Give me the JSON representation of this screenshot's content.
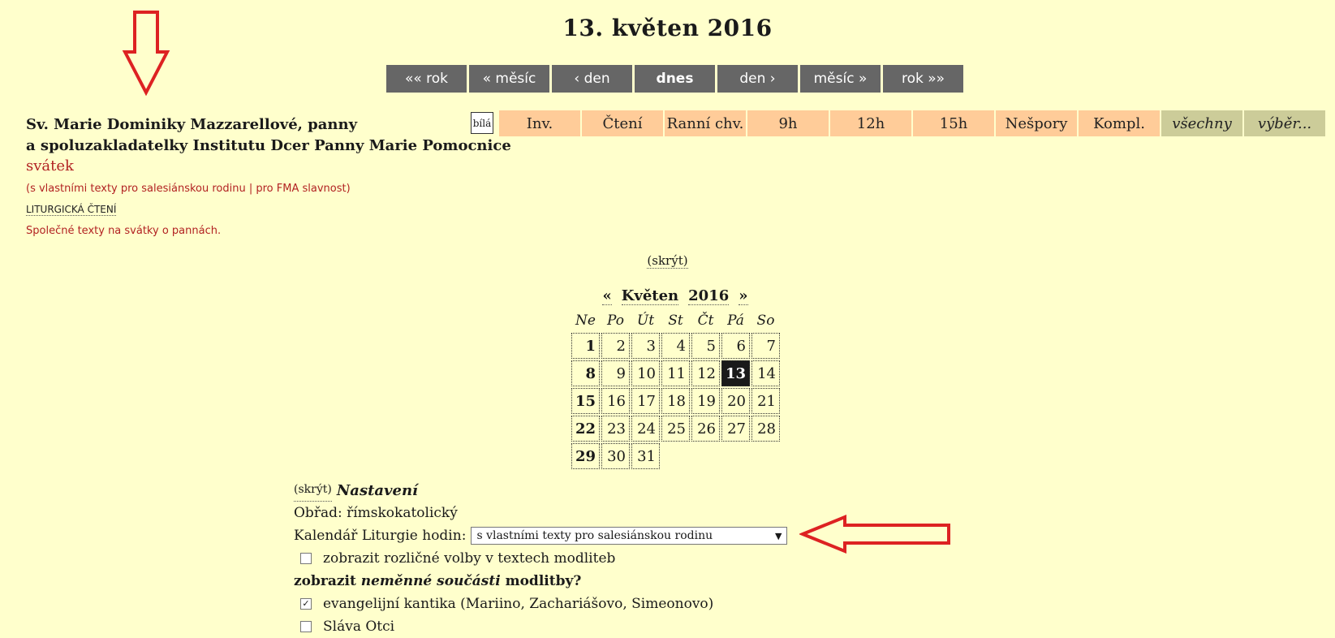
{
  "title": "13. květen 2016",
  "nav": [
    {
      "label": "«« rok"
    },
    {
      "label": "« měsíc"
    },
    {
      "label": "‹ den"
    },
    {
      "label": "dnes"
    },
    {
      "label": "den ›"
    },
    {
      "label": "měsíc »"
    },
    {
      "label": "rok »»"
    }
  ],
  "saint": {
    "line1": "Sv. Marie Dominiky Mazzarellové, panny",
    "line2": "a spoluzakladatelky Institutu Dcer Panny Marie Pomocnice",
    "rank": "svátek",
    "note_open": "(s vlastními texty pro salesiánskou rodinu | pro FMA slavnost)",
    "lit_readings": "LITURGICKÁ ČTENÍ",
    "common_texts": "Společné texty na svátky o pannách."
  },
  "liturgical_color": "bílá",
  "hours": [
    {
      "label": "Inv.",
      "extra": false
    },
    {
      "label": "Čtení",
      "extra": false
    },
    {
      "label": "Ranní chv.",
      "extra": false
    },
    {
      "label": "9h",
      "extra": false
    },
    {
      "label": "12h",
      "extra": false
    },
    {
      "label": "15h",
      "extra": false
    },
    {
      "label": "Nešpory",
      "extra": false
    },
    {
      "label": "Kompl.",
      "extra": false
    },
    {
      "label": "všechny",
      "extra": true
    },
    {
      "label": "výběr...",
      "extra": true
    }
  ],
  "hide_label": "(skrýt)",
  "calendar": {
    "prev": "«",
    "month": "Květen",
    "year": "2016",
    "next": "»",
    "weekdays": [
      "Ne",
      "Po",
      "Út",
      "St",
      "Čt",
      "Pá",
      "So"
    ],
    "days": [
      "1",
      "2",
      "3",
      "4",
      "5",
      "6",
      "7",
      "8",
      "9",
      "10",
      "11",
      "12",
      "13",
      "14",
      "15",
      "16",
      "17",
      "18",
      "19",
      "20",
      "21",
      "22",
      "23",
      "24",
      "25",
      "26",
      "27",
      "28",
      "29",
      "30",
      "31"
    ],
    "today": "13"
  },
  "settings": {
    "hide": "(skrýt)",
    "title": "Nastavení",
    "rite": "Obřad: římskokatolický",
    "calendar_label": "Kalendář Liturgie hodin:",
    "calendar_value": "s vlastními texty pro salesiánskou rodinu",
    "option_various": "zobrazit rozličné volby v textech modliteb",
    "invariant_pre": "zobrazit ",
    "invariant_em": "neměnné součásti",
    "invariant_post": " modlitby?",
    "canticles": "evangelijní kantika (Mariino, Zachariášovo, Simeonovo)",
    "gloria": "Sláva Otci"
  },
  "colors": {
    "background": "#ffffcc",
    "nav": "#666666",
    "hour": "#ffcc99",
    "hour_extra": "#cccc99",
    "red": "#b22222",
    "annotation_arrow": "#dd2222"
  }
}
